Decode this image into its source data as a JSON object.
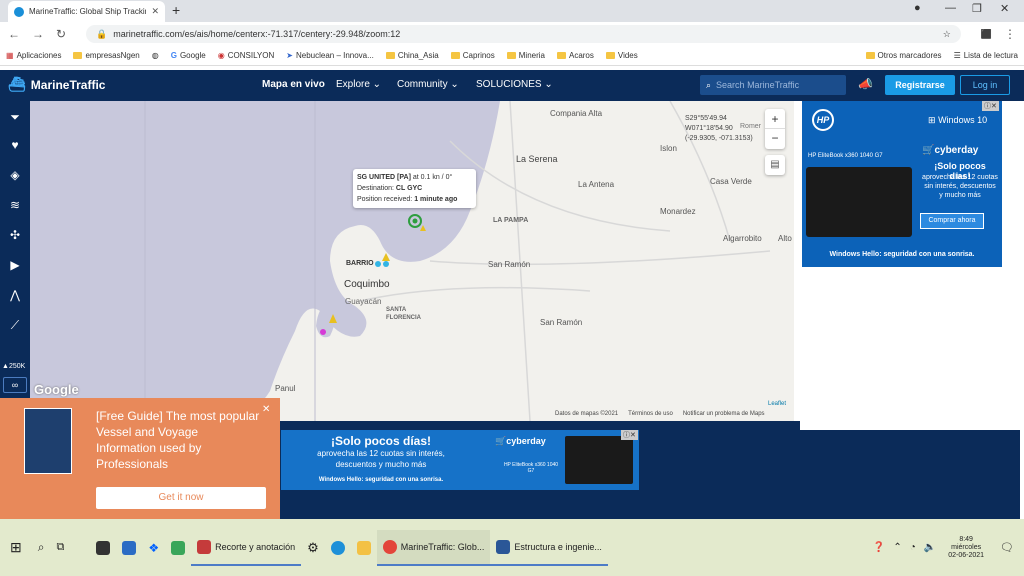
{
  "browser": {
    "tab_title": "MarineTraffic: Global Ship Trackin",
    "url": "marinetraffic.com/es/ais/home/centerx:-71.317/centery:-29.948/zoom:12",
    "bookmarks": [
      "Aplicaciones",
      "empresasNgen",
      "Google",
      "CONSILYON",
      "Nebuclean – Innova...",
      "China_Asia",
      "Caprinos",
      "Mineria",
      "Acaros",
      "Vides"
    ],
    "other_bookmarks": "Otros marcadores",
    "reading_list": "Lista de lectura"
  },
  "nav": {
    "brand": "MarineTraffic",
    "links": [
      "Mapa en vivo",
      "Explore ⌄",
      "Community ⌄",
      "SOLUCIONES ⌄"
    ],
    "search_placeholder": "Search MarineTraffic",
    "register": "Registrarse",
    "login": "Log in"
  },
  "sidebar": {
    "counter": "250K",
    "infinity": "∞"
  },
  "map": {
    "places": [
      "Compania Alta",
      "La Serena",
      "La Antena",
      "LA PAMPA",
      "Monardez",
      "Casa Verde",
      "Algarrobito",
      "Alto",
      "Islon",
      "San Ramón",
      "San Ramón",
      "BARRIO",
      "Coquimbo",
      "Guayacán",
      "SANTA FLORENCIA",
      "Panul",
      "Romer"
    ],
    "coords": [
      "S29°55'49.94",
      "W071°18'54.90",
      "(-29.9305, -071.3153)"
    ],
    "tooltip": {
      "name": "SG UNITED [PA]",
      "speed": " at 0.1 kn / 0°",
      "dest_label": "Destination: ",
      "dest": "CL GYC",
      "pos_label": "Position received: ",
      "pos": "1 minute ago"
    },
    "attrib": [
      "Datos de mapas ©2021",
      "Términos de uso",
      "Notificar un problema de Maps"
    ],
    "leaflet": "Leaflet",
    "google": "Google",
    "zoom_in": "+",
    "zoom_out": "−"
  },
  "ad_right": {
    "brand": "HP",
    "os": "Windows 10",
    "store": "cyberday",
    "headline": "¡Solo pocos días!",
    "body": "aprovecha las 12 cuotas sin interés, descuentos y mucho más",
    "cta": "Comprar ahora",
    "model": "HP EliteBook x360 1040 G7",
    "footer": "Windows Hello: seguridad con una sonrisa."
  },
  "ad_bottom": {
    "headline": "¡Solo pocos días!",
    "body1": "aprovecha las 12 cuotas sin interés,",
    "body2": "descuentos y mucho más",
    "footer": "Windows Hello: seguridad con una sonrisa.",
    "store": "cyberday",
    "model": "HP EliteBook x360 1040 G7"
  },
  "guide": {
    "text": "[Free Guide] The most popular Vessel and Voyage Information used by Professionals",
    "cta": "Get it now",
    "close": "✕"
  },
  "taskbar": {
    "items": [
      "Recorte y anotación",
      "MarineTraffic: Glob...",
      "Estructura e ingenie..."
    ],
    "time": "8:49",
    "day": "miércoles",
    "date": "02-06-2021"
  },
  "colors": {
    "nav": "#0b2b59",
    "accent": "#1a9be6",
    "sea": "#c8c8dc",
    "guide": "#e8895a"
  }
}
